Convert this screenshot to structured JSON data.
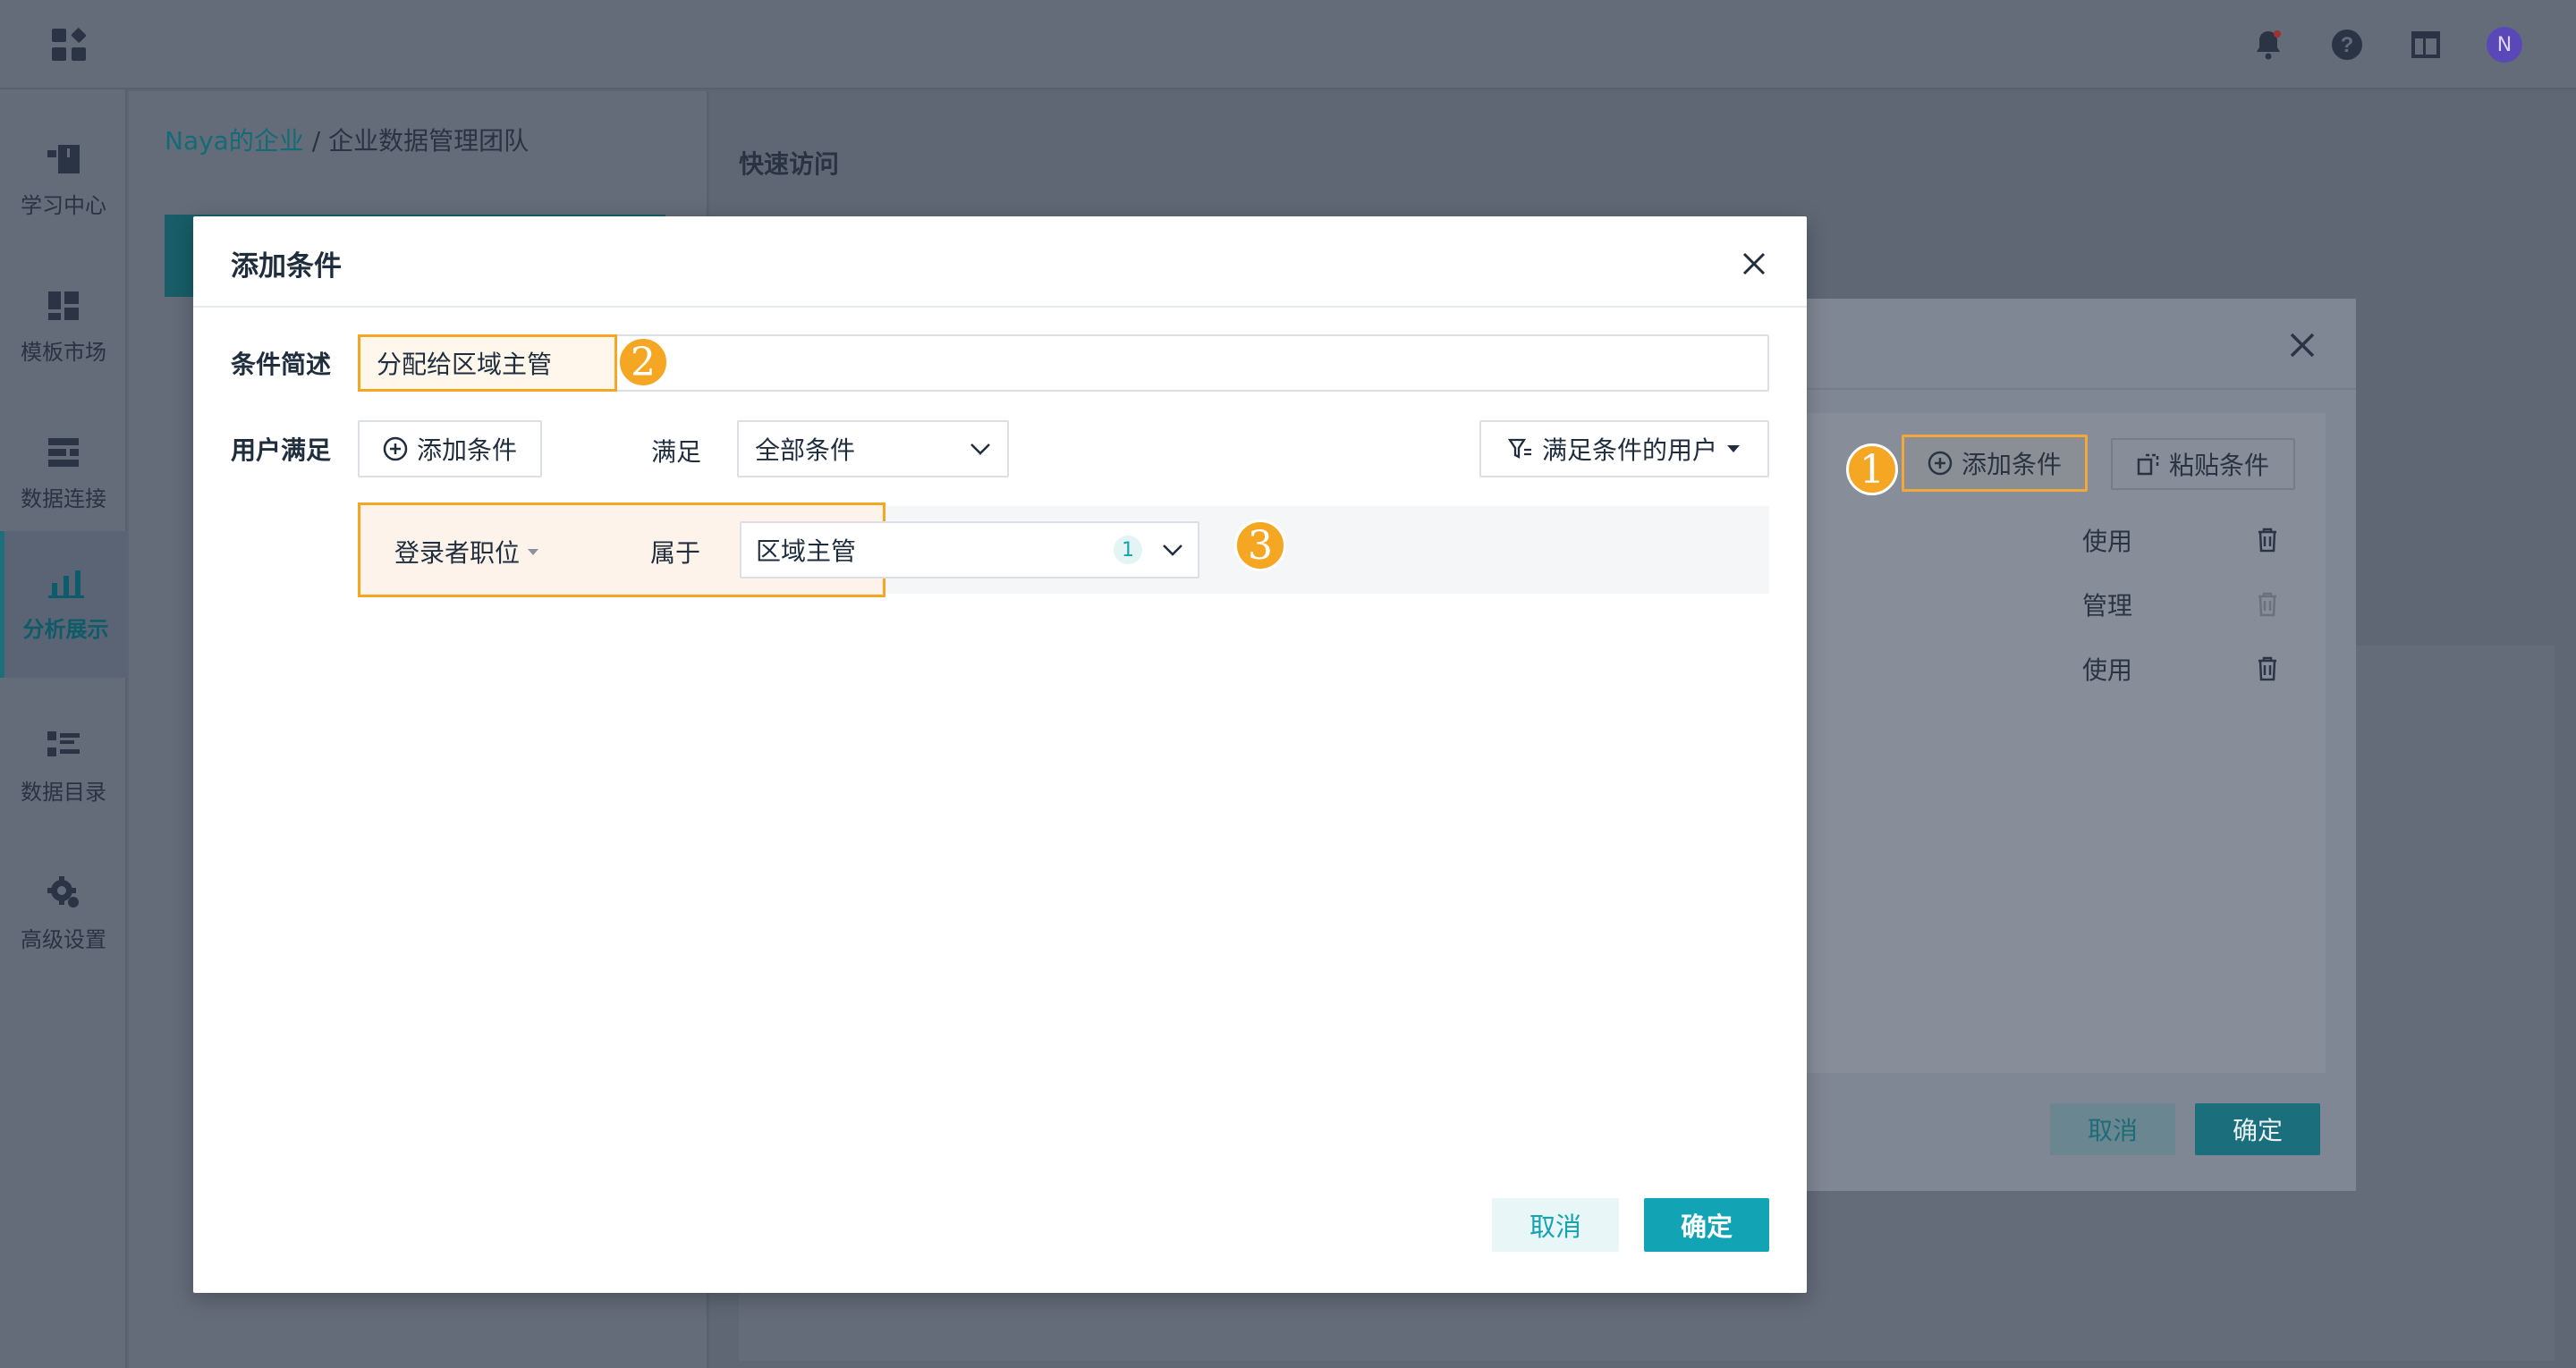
{
  "app": {
    "breadcrumb": {
      "org": "Naya的企业",
      "separator": "/",
      "team": "企业数据管理团队"
    },
    "nav_items": [
      {
        "label": "学习中心",
        "icon": "book-icon"
      },
      {
        "label": "模板市场",
        "icon": "template-icon"
      },
      {
        "label": "数据连接",
        "icon": "connection-icon"
      },
      {
        "label": "分析展示",
        "icon": "analysis-icon",
        "active": true
      },
      {
        "label": "数据目录",
        "icon": "catalog-icon"
      },
      {
        "label": "高级设置",
        "icon": "gear-icon"
      }
    ],
    "quick_access": "快速访问",
    "avatar_initial": "N"
  },
  "back_dialog": {
    "add_condition": "添加条件",
    "paste_condition": "粘贴条件",
    "permissions": [
      "使用",
      "管理",
      "使用"
    ],
    "cancel": "取消",
    "ok": "确定"
  },
  "badges": {
    "one": "1",
    "two": "2",
    "three": "3"
  },
  "dialog": {
    "title": "添加条件",
    "desc_label": "条件简述",
    "desc_value": "分配给区域主管",
    "users_label": "用户满足",
    "add_condition": "添加条件",
    "meet_label": "满足",
    "meet_value": "全部条件",
    "users_button": "满足条件的用户",
    "condition": {
      "field": "登录者职位",
      "operator": "属于",
      "value": "区域主管",
      "count": "1"
    },
    "cancel": "取消",
    "ok": "确定"
  },
  "colors": {
    "accent": "#12a4b5",
    "highlight": "#f5a623"
  }
}
